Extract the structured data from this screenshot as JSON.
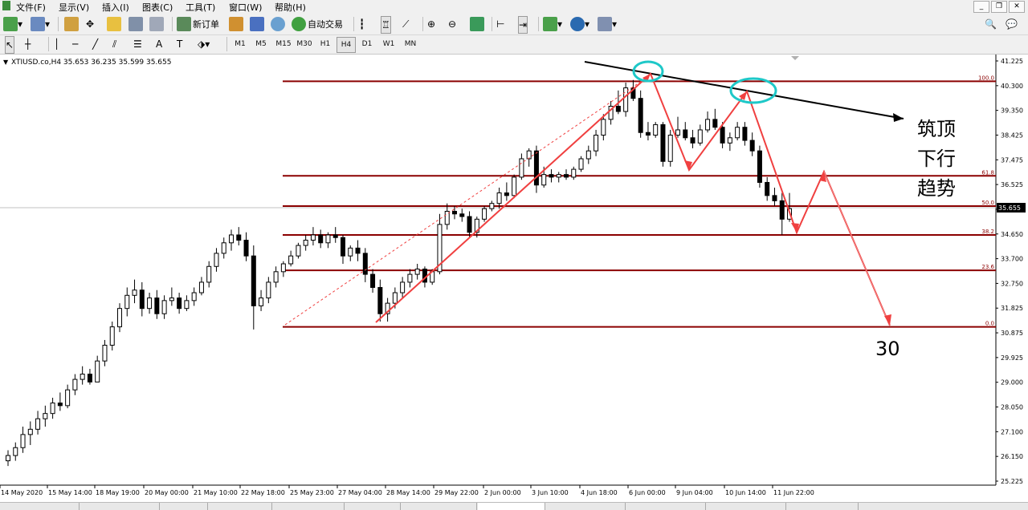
{
  "menu": [
    "文件(F)",
    "显示(V)",
    "插入(I)",
    "图表(C)",
    "工具(T)",
    "窗口(W)",
    "帮助(H)"
  ],
  "toolbar": {
    "new_order_label": "新订单",
    "auto_trade_label": "自动交易"
  },
  "timeframes": [
    "M1",
    "M5",
    "M15",
    "M30",
    "H1",
    "H4",
    "D1",
    "W1",
    "MN"
  ],
  "active_timeframe": "H4",
  "chart_header": "XTIUSD.co,H4  35.653 36.235 35.599 35.655",
  "annotations": {
    "text_lines": [
      "筑顶",
      "下行",
      "趋势"
    ],
    "target": "30"
  },
  "colors": {
    "fib_line": "#8b0000",
    "annotation_arrow": "#f04040",
    "highlight_circle": "#1ec8c8",
    "trendline": "#000000",
    "candle": "#000000",
    "price_badge_bg": "#000000"
  },
  "chart_data": {
    "type": "candlestick",
    "symbol": "XTIUSD.co",
    "timeframe": "H4",
    "header": {
      "open": 35.653,
      "high": 36.235,
      "low": 35.599,
      "close": 35.655
    },
    "current_price": "35.655",
    "ylim": [
      25.225,
      41.225
    ],
    "y_ticks": [
      "41.225",
      "40.300",
      "39.350",
      "38.425",
      "37.475",
      "36.525",
      "35.600",
      "34.650",
      "33.700",
      "32.750",
      "31.825",
      "30.875",
      "29.925",
      "29.000",
      "28.050",
      "27.100",
      "26.150",
      "25.225"
    ],
    "x_ticks": [
      "14 May 2020",
      "15 May 14:00",
      "18 May 19:00",
      "20 May 00:00",
      "21 May 10:00",
      "22 May 18:00",
      "25 May 23:00",
      "27 May 04:00",
      "28 May 14:00",
      "29 May 22:00",
      "2 Jun 00:00",
      "3 Jun 10:00",
      "4 Jun 18:00",
      "6 Jun 00:00",
      "9 Jun 04:00",
      "10 Jun 14:00",
      "11 Jun 22:00"
    ],
    "fib_levels": [
      {
        "label": "100.0",
        "value": 40.45
      },
      {
        "label": "61.8",
        "value": 36.85
      },
      {
        "label": "50.0",
        "value": 35.7
      },
      {
        "label": "38.2",
        "value": 34.6
      },
      {
        "label": "23.6",
        "value": 33.25
      },
      {
        "label": "0.0",
        "value": 31.1
      }
    ],
    "candles": [
      [
        26.0,
        26.4,
        25.8,
        26.2
      ],
      [
        26.2,
        26.7,
        26.0,
        26.5
      ],
      [
        26.5,
        27.3,
        26.3,
        27.0
      ],
      [
        27.0,
        27.5,
        26.6,
        27.2
      ],
      [
        27.2,
        27.9,
        27.0,
        27.6
      ],
      [
        27.6,
        28.1,
        27.3,
        27.8
      ],
      [
        27.8,
        28.4,
        27.6,
        28.2
      ],
      [
        28.2,
        28.6,
        27.9,
        28.1
      ],
      [
        28.1,
        28.9,
        28.0,
        28.7
      ],
      [
        28.7,
        29.3,
        28.5,
        29.1
      ],
      [
        29.1,
        29.6,
        28.9,
        29.3
      ],
      [
        29.3,
        29.5,
        28.9,
        29.0
      ],
      [
        29.0,
        30.0,
        29.0,
        29.8
      ],
      [
        29.8,
        30.6,
        29.6,
        30.4
      ],
      [
        30.4,
        31.3,
        30.2,
        31.1
      ],
      [
        31.1,
        32.0,
        30.9,
        31.8
      ],
      [
        31.8,
        32.6,
        31.5,
        32.3
      ],
      [
        32.3,
        32.9,
        32.0,
        32.5
      ],
      [
        32.5,
        32.8,
        31.5,
        31.8
      ],
      [
        31.8,
        32.4,
        31.6,
        32.2
      ],
      [
        32.2,
        32.5,
        31.4,
        31.6
      ],
      [
        31.6,
        32.3,
        31.4,
        32.1
      ],
      [
        32.1,
        32.6,
        31.9,
        32.2
      ],
      [
        32.2,
        32.4,
        31.6,
        31.8
      ],
      [
        31.8,
        32.3,
        31.7,
        32.1
      ],
      [
        32.1,
        32.6,
        31.9,
        32.4
      ],
      [
        32.4,
        33.0,
        32.3,
        32.8
      ],
      [
        32.8,
        33.6,
        32.6,
        33.4
      ],
      [
        33.4,
        34.1,
        33.2,
        33.9
      ],
      [
        33.9,
        34.5,
        33.7,
        34.3
      ],
      [
        34.3,
        34.8,
        34.0,
        34.6
      ],
      [
        34.6,
        34.9,
        34.2,
        34.4
      ],
      [
        34.4,
        34.7,
        33.6,
        33.8
      ],
      [
        33.8,
        34.2,
        31.0,
        31.9
      ],
      [
        31.9,
        32.5,
        31.7,
        32.2
      ],
      [
        32.2,
        33.0,
        32.0,
        32.8
      ],
      [
        32.8,
        33.4,
        32.6,
        33.2
      ],
      [
        33.2,
        33.6,
        33.0,
        33.5
      ],
      [
        33.5,
        34.0,
        33.4,
        33.8
      ],
      [
        33.8,
        34.3,
        33.7,
        34.2
      ],
      [
        34.2,
        34.6,
        34.0,
        34.4
      ],
      [
        34.4,
        34.9,
        34.2,
        34.6
      ],
      [
        34.6,
        34.8,
        34.1,
        34.3
      ],
      [
        34.3,
        34.7,
        34.1,
        34.6
      ],
      [
        34.6,
        34.9,
        34.3,
        34.5
      ],
      [
        34.5,
        34.6,
        33.5,
        33.8
      ],
      [
        33.8,
        34.2,
        33.6,
        34.1
      ],
      [
        34.1,
        34.4,
        33.6,
        33.9
      ],
      [
        33.9,
        34.1,
        32.8,
        33.1
      ],
      [
        33.1,
        33.3,
        32.4,
        32.6
      ],
      [
        32.6,
        32.9,
        31.3,
        31.6
      ],
      [
        31.6,
        32.2,
        31.3,
        32.0
      ],
      [
        32.0,
        32.6,
        31.8,
        32.4
      ],
      [
        32.4,
        33.0,
        32.2,
        32.8
      ],
      [
        32.8,
        33.3,
        32.6,
        33.1
      ],
      [
        33.1,
        33.5,
        32.9,
        33.3
      ],
      [
        33.3,
        33.4,
        32.6,
        32.8
      ],
      [
        32.8,
        33.3,
        32.7,
        33.2
      ],
      [
        33.2,
        35.4,
        33.1,
        35.0
      ],
      [
        35.0,
        35.8,
        34.8,
        35.5
      ],
      [
        35.5,
        35.7,
        35.2,
        35.4
      ],
      [
        35.4,
        35.6,
        35.1,
        35.3
      ],
      [
        35.3,
        35.5,
        34.5,
        34.7
      ],
      [
        34.7,
        35.3,
        34.5,
        35.2
      ],
      [
        35.2,
        35.7,
        35.1,
        35.6
      ],
      [
        35.6,
        35.9,
        35.5,
        35.8
      ],
      [
        35.8,
        36.4,
        35.6,
        36.2
      ],
      [
        36.2,
        36.6,
        35.9,
        36.1
      ],
      [
        36.1,
        36.9,
        36.0,
        36.8
      ],
      [
        36.8,
        37.7,
        36.7,
        37.5
      ],
      [
        37.5,
        37.9,
        37.2,
        37.8
      ],
      [
        37.8,
        38.0,
        36.2,
        36.5
      ],
      [
        36.5,
        37.2,
        36.4,
        36.9
      ],
      [
        36.9,
        37.1,
        36.6,
        36.8
      ],
      [
        36.8,
        37.0,
        36.6,
        36.9
      ],
      [
        36.9,
        37.1,
        36.7,
        36.8
      ],
      [
        36.8,
        37.2,
        36.7,
        37.1
      ],
      [
        37.1,
        37.6,
        37.0,
        37.5
      ],
      [
        37.5,
        38.0,
        37.3,
        37.8
      ],
      [
        37.8,
        38.6,
        37.6,
        38.4
      ],
      [
        38.4,
        39.2,
        38.2,
        39.0
      ],
      [
        39.0,
        39.7,
        38.8,
        39.5
      ],
      [
        39.5,
        40.1,
        39.2,
        39.3
      ],
      [
        39.3,
        40.4,
        39.1,
        40.2
      ],
      [
        40.2,
        40.5,
        39.7,
        39.8
      ],
      [
        39.8,
        40.1,
        38.3,
        38.5
      ],
      [
        38.5,
        38.9,
        38.2,
        38.4
      ],
      [
        38.4,
        38.9,
        38.3,
        38.8
      ],
      [
        38.8,
        38.9,
        37.2,
        37.4
      ],
      [
        37.4,
        38.6,
        37.2,
        38.4
      ],
      [
        38.4,
        39.1,
        38.3,
        38.6
      ],
      [
        38.6,
        38.9,
        38.2,
        38.3
      ],
      [
        38.3,
        38.6,
        37.9,
        38.1
      ],
      [
        38.1,
        38.8,
        38.0,
        38.6
      ],
      [
        38.6,
        39.3,
        38.5,
        39.0
      ],
      [
        39.0,
        39.4,
        38.6,
        38.7
      ],
      [
        38.7,
        38.9,
        37.9,
        38.1
      ],
      [
        38.1,
        38.5,
        37.8,
        38.3
      ],
      [
        38.3,
        38.9,
        38.2,
        38.7
      ],
      [
        38.7,
        38.9,
        38.0,
        38.2
      ],
      [
        38.2,
        38.5,
        37.6,
        37.8
      ],
      [
        37.8,
        38.0,
        36.4,
        36.6
      ],
      [
        36.6,
        36.8,
        35.9,
        36.1
      ],
      [
        36.1,
        36.4,
        35.7,
        35.9
      ],
      [
        35.9,
        36.2,
        34.6,
        35.2
      ],
      [
        35.2,
        36.2,
        35.1,
        35.6
      ]
    ]
  }
}
